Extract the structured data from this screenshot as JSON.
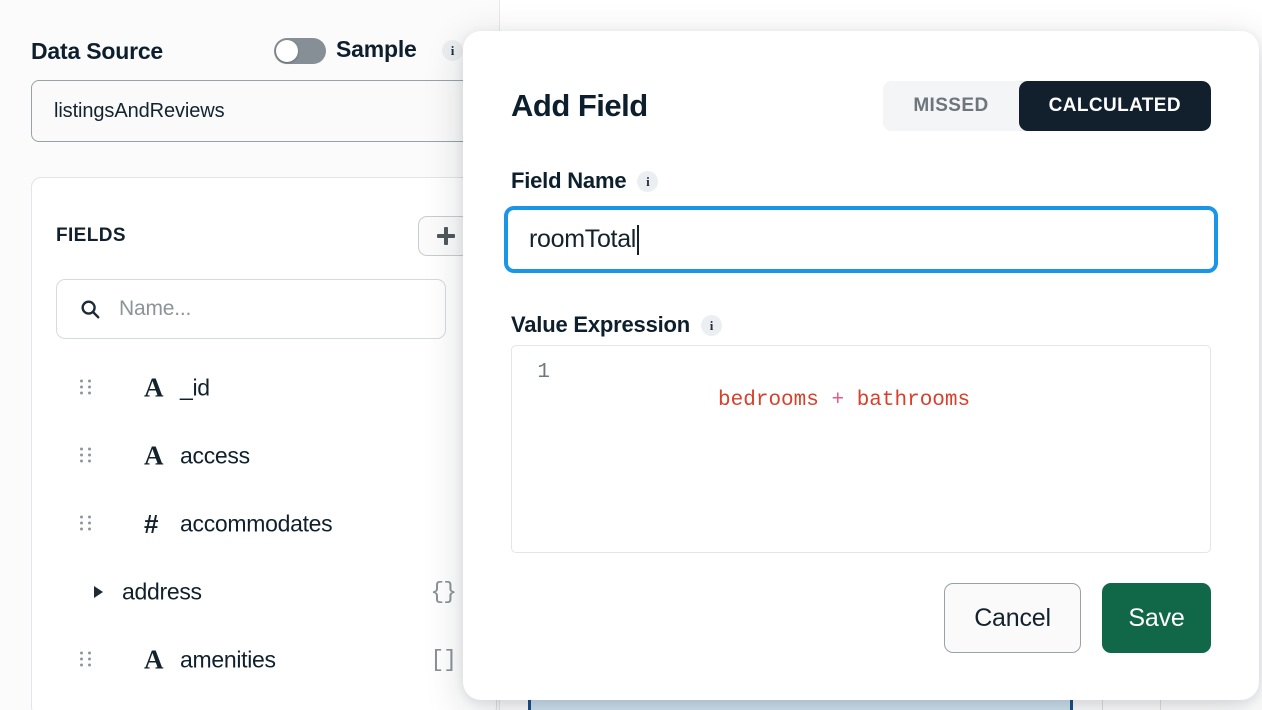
{
  "left_panel": {
    "data_source_title": "Data Source",
    "sample_toggle": {
      "label": "Sample",
      "state": "off",
      "track_color": "#868e96",
      "knob_color": "#ffffff"
    },
    "info_icon_glyph": "i",
    "data_source_value": "listingsAndReviews",
    "fields_section": {
      "title": "FIELDS",
      "add_button_icon": "plus-icon",
      "search_placeholder": "Name...",
      "search_value": "",
      "items": [
        {
          "name": "_id",
          "type_icon": "A",
          "kind": "string",
          "badge": "",
          "draggable": true,
          "expandable": false
        },
        {
          "name": "access",
          "type_icon": "A",
          "kind": "string",
          "badge": "",
          "draggable": true,
          "expandable": false
        },
        {
          "name": "accommodates",
          "type_icon": "#",
          "kind": "number",
          "badge": "",
          "draggable": true,
          "expandable": false
        },
        {
          "name": "address",
          "type_icon": "",
          "kind": "object",
          "badge": "{}",
          "draggable": false,
          "expandable": true
        },
        {
          "name": "amenities",
          "type_icon": "A",
          "kind": "array",
          "badge": "[]",
          "draggable": true,
          "expandable": false
        }
      ]
    }
  },
  "modal": {
    "title": "Add Field",
    "segmented_control": {
      "options": [
        "MISSED",
        "CALCULATED"
      ],
      "selected": "CALCULATED",
      "active_bg": "#11202c",
      "active_fg": "#ffffff",
      "inactive_bg": "#f4f5f6",
      "inactive_fg": "#6d767d"
    },
    "field_name": {
      "label": "Field Name",
      "info_icon_glyph": "i",
      "value": "roomTotal",
      "placeholder": "",
      "focused": true,
      "focus_ring_color": "#1a96e8"
    },
    "value_expression": {
      "label": "Value Expression",
      "info_icon_glyph": "i",
      "line_number": "1",
      "expression": "bedrooms + bathrooms",
      "tokens": [
        {
          "text": "bedrooms",
          "type": "identifier",
          "color": "#d7402b"
        },
        {
          "text": " ",
          "type": "space",
          "color": ""
        },
        {
          "text": "+",
          "type": "operator",
          "color": "#e8588a"
        },
        {
          "text": " ",
          "type": "space",
          "color": ""
        },
        {
          "text": "bathrooms",
          "type": "identifier",
          "color": "#d7402b"
        }
      ]
    },
    "buttons": {
      "cancel_label": "Cancel",
      "save_label": "Save",
      "save_color": "#116849"
    }
  },
  "background_table": {
    "selected_row_fill": "#cfe3f0",
    "selected_row_border": "#1d4f8c"
  }
}
